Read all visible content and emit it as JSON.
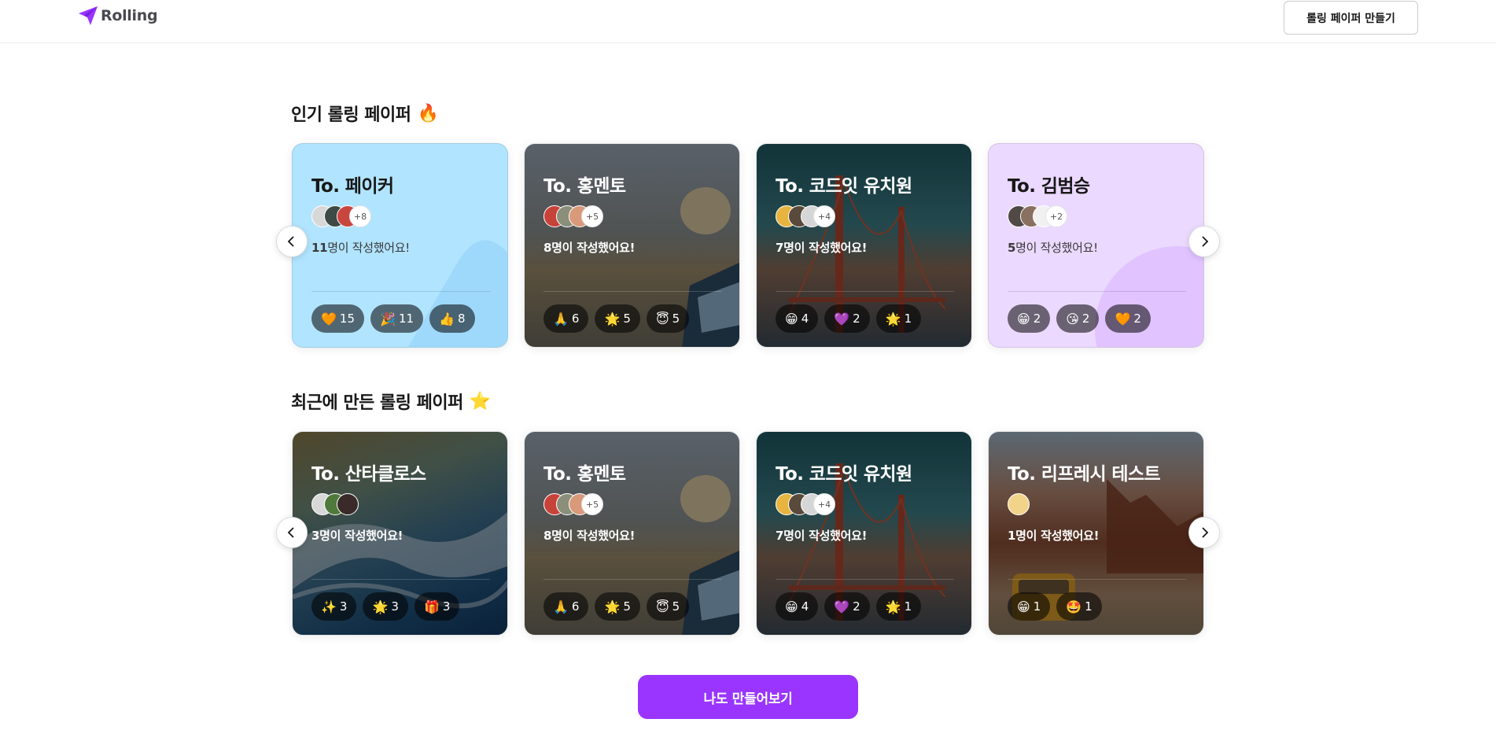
{
  "header": {
    "logo_text": "Rolling",
    "create_button": "롤링 페이퍼 만들기"
  },
  "popular": {
    "title": "인기 롤링 페이퍼",
    "title_emoji": "🔥",
    "cards": [
      {
        "to": "To. 페이커",
        "more": "+8",
        "count": "11",
        "suffix": "명이 작성했어요!",
        "theme": "light-blue",
        "reactions": [
          {
            "emoji": "🧡",
            "count": "15"
          },
          {
            "emoji": "🎉",
            "count": "11"
          },
          {
            "emoji": "👍",
            "count": "8"
          }
        ]
      },
      {
        "to": "To. 홍멘토",
        "more": "+5",
        "count": "8",
        "suffix": "명이 작성했어요!",
        "theme": "photo-road",
        "reactions": [
          {
            "emoji": "🙏",
            "count": "6"
          },
          {
            "emoji": "🌟",
            "count": "5"
          },
          {
            "emoji": "😇",
            "count": "5"
          }
        ]
      },
      {
        "to": "To. 코드잇 유치원",
        "more": "+4",
        "count": "7",
        "suffix": "명이 작성했어요!",
        "theme": "photo-bridge",
        "reactions": [
          {
            "emoji": "😁",
            "count": "4"
          },
          {
            "emoji": "💜",
            "count": "2"
          },
          {
            "emoji": "🌟",
            "count": "1"
          }
        ]
      },
      {
        "to": "To. 김범승",
        "more": "+2",
        "count": "5",
        "suffix": "명이 작성했어요!",
        "theme": "light-purple",
        "reactions": [
          {
            "emoji": "😁",
            "count": "2"
          },
          {
            "emoji": "😘",
            "count": "2"
          },
          {
            "emoji": "🧡",
            "count": "2"
          }
        ]
      }
    ]
  },
  "recent": {
    "title": "최근에 만든 롤링 페이퍼",
    "title_emoji": "⭐",
    "cards": [
      {
        "to": "To. 산타클로스",
        "more": "",
        "count": "3",
        "suffix": "명이 작성했어요!",
        "theme": "photo-ocean",
        "reactions": [
          {
            "emoji": "✨",
            "count": "3"
          },
          {
            "emoji": "🌟",
            "count": "3"
          },
          {
            "emoji": "🎁",
            "count": "3"
          }
        ]
      },
      {
        "to": "To. 홍멘토",
        "more": "+5",
        "count": "8",
        "suffix": "명이 작성했어요!",
        "theme": "photo-road",
        "reactions": [
          {
            "emoji": "🙏",
            "count": "6"
          },
          {
            "emoji": "🌟",
            "count": "5"
          },
          {
            "emoji": "😇",
            "count": "5"
          }
        ]
      },
      {
        "to": "To. 코드잇 유치원",
        "more": "+4",
        "count": "7",
        "suffix": "명이 작성했어요!",
        "theme": "photo-bridge",
        "reactions": [
          {
            "emoji": "😁",
            "count": "4"
          },
          {
            "emoji": "💜",
            "count": "2"
          },
          {
            "emoji": "🌟",
            "count": "1"
          }
        ]
      },
      {
        "to": "To. 리프레시 테스트",
        "more": "",
        "count": "1",
        "suffix": "명이 작성했어요!",
        "theme": "photo-canyon",
        "reactions": [
          {
            "emoji": "😁",
            "count": "1"
          },
          {
            "emoji": "🤩",
            "count": "1"
          }
        ]
      }
    ]
  },
  "cta_button": "나도 만들어보기",
  "colors": {
    "brand": "#9935ff",
    "light_blue": "#b1e4ff",
    "light_purple": "#ecd9ff"
  },
  "icons": [
    "logo-plane-icon",
    "chevron-left-icon",
    "chevron-right-icon"
  ]
}
